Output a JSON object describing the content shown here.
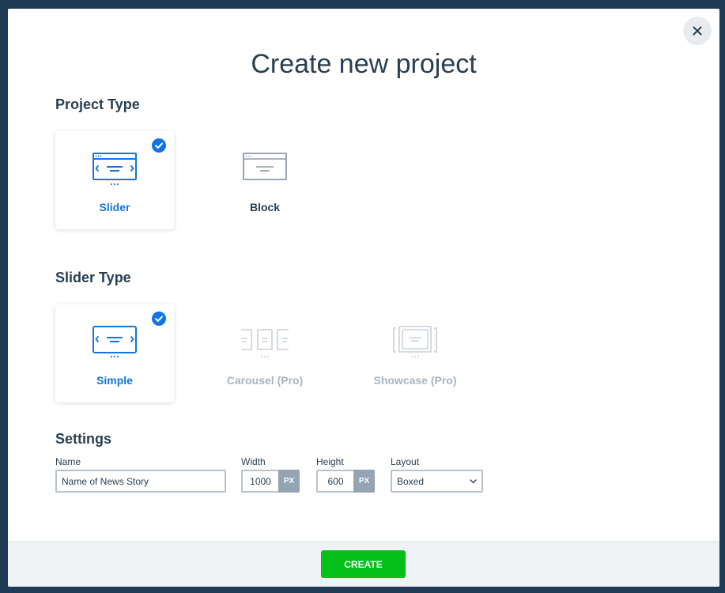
{
  "modal": {
    "title": "Create new project",
    "close_icon": "close-icon"
  },
  "project_type": {
    "heading": "Project Type",
    "options": [
      {
        "label": "Slider",
        "icon": "slider-icon",
        "selected": true
      },
      {
        "label": "Block",
        "icon": "block-icon",
        "selected": false
      }
    ]
  },
  "slider_type": {
    "heading": "Slider Type",
    "options": [
      {
        "label": "Simple",
        "icon": "simple-slider-icon",
        "selected": true
      },
      {
        "label": "Carousel (Pro)",
        "icon": "carousel-icon",
        "selected": false,
        "disabled": true
      },
      {
        "label": "Showcase (Pro)",
        "icon": "showcase-icon",
        "selected": false,
        "disabled": true
      }
    ]
  },
  "settings": {
    "heading": "Settings",
    "name": {
      "label": "Name",
      "value": "Name of News Story"
    },
    "width": {
      "label": "Width",
      "value": "1000",
      "unit": "PX"
    },
    "height": {
      "label": "Height",
      "value": "600",
      "unit": "PX"
    },
    "layout": {
      "label": "Layout",
      "value": "Boxed"
    }
  },
  "footer": {
    "create_label": "CREATE"
  },
  "colors": {
    "accent": "#1375e0",
    "create": "#04c018",
    "text": "#283f52",
    "disabled": "#a9b4bf",
    "backdrop": "#1f3b56"
  }
}
